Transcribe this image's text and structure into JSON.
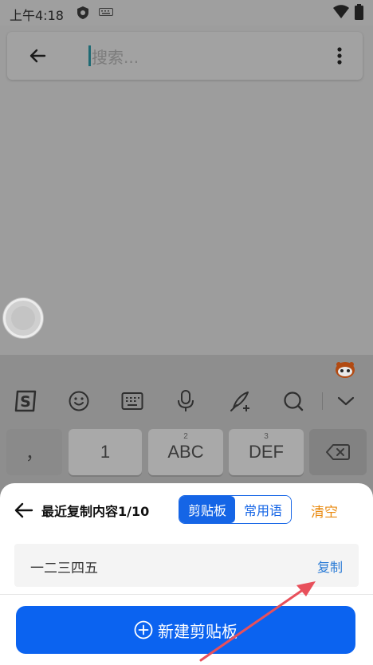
{
  "status_bar": {
    "time": "上午4:18"
  },
  "search": {
    "placeholder": "搜索..."
  },
  "keyboard": {
    "toolbar_icons": [
      "sogou-logo-icon",
      "emoji-icon",
      "keyboard-icon",
      "microphone-icon",
      "handwriting-icon",
      "search-icon",
      "chevron-down-icon"
    ],
    "keys": [
      {
        "label": "，",
        "sup": ""
      },
      {
        "label": "1",
        "sup": ""
      },
      {
        "label": "ABC",
        "sup": "2"
      },
      {
        "label": "DEF",
        "sup": "3"
      }
    ]
  },
  "clipboard_panel": {
    "title": "最近复制内容1/10",
    "tabs": [
      "剪贴板",
      "常用语"
    ],
    "active_tab": "剪贴板",
    "clear_label": "清空",
    "items": [
      {
        "text": "一二三四五",
        "copy_label": "复制"
      }
    ],
    "new_button_label": "新建剪贴板",
    "colors": {
      "accent": "#0b63f0",
      "clear": "#e98a10",
      "annotation_arrow": "#e8505b"
    }
  }
}
